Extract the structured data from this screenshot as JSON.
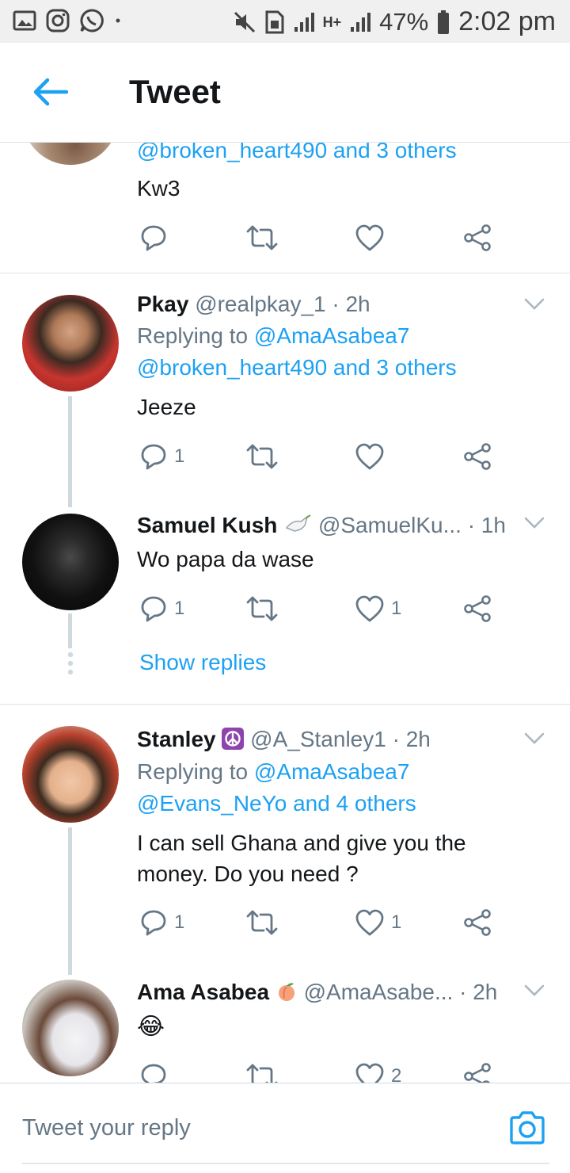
{
  "status_bar": {
    "battery": "47%",
    "time": "2:02 pm",
    "network": "H+"
  },
  "header": {
    "title": "Tweet"
  },
  "tweets": [
    {
      "replying_prefix": "",
      "replying_to": "@broken_heart490 and 3 others",
      "text": "Kw3",
      "reply_count": "",
      "like_count": ""
    },
    {
      "name": "Pkay",
      "handle": "@realpkay_1",
      "time": "· 2h",
      "replying_prefix": "Replying to",
      "replying_to_1": "@AmaAsabea7",
      "replying_to_2": "@broken_heart490 and 3 others",
      "text": "Jeeze",
      "reply_count": "1",
      "like_count": ""
    },
    {
      "name": "Samuel Kush",
      "handle": "@SamuelKu...",
      "time": "· 1h",
      "text": "Wo papa da wase",
      "reply_count": "1",
      "like_count": "1",
      "show_replies": "Show replies"
    },
    {
      "name": "Stanley",
      "handle": "@A_Stanley1",
      "time": "· 2h",
      "replying_prefix": "Replying to",
      "replying_to_1": "@AmaAsabea7",
      "replying_to_2": "@Evans_NeYo and 4 others",
      "text_line1": "I can sell Ghana and give you the",
      "text_line2": "money. Do you need ?",
      "reply_count": "1",
      "like_count": "1"
    },
    {
      "name": "Ama Asabea",
      "handle": "@AmaAsabe...",
      "time": "· 2h",
      "text": "😂",
      "reply_count": "",
      "like_count": "2"
    }
  ],
  "reply_bar": {
    "placeholder": "Tweet your reply"
  },
  "colors": {
    "accent": "#1da1f2",
    "muted": "#657786",
    "divider": "#dfe3e6"
  }
}
